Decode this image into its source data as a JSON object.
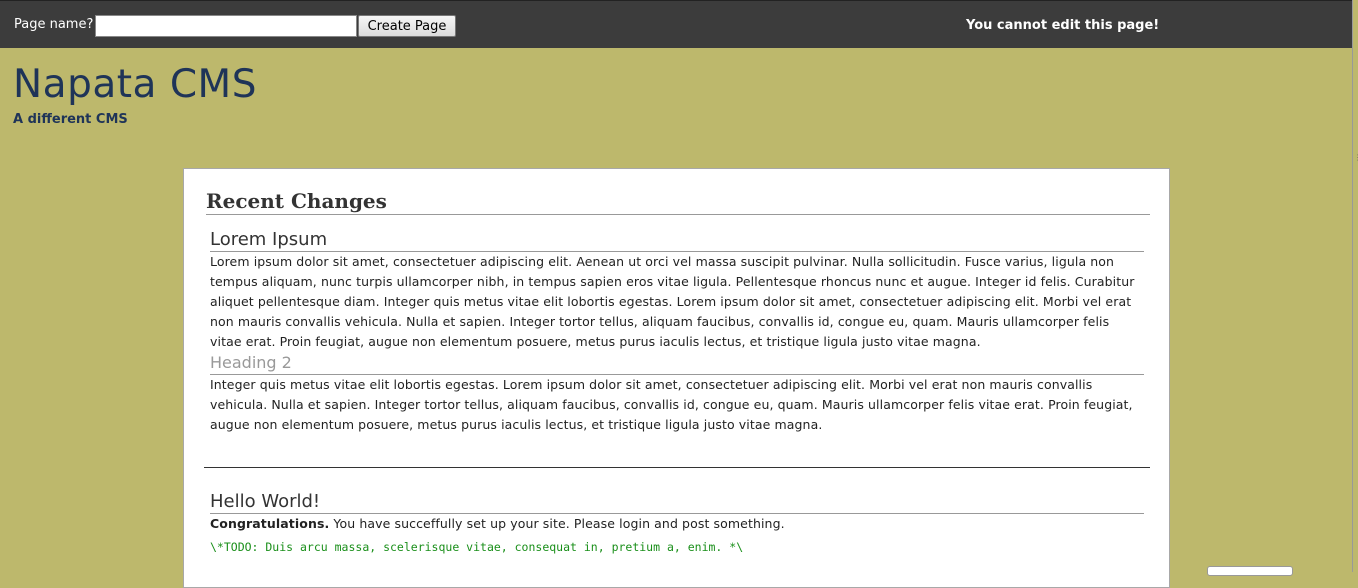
{
  "toolbar": {
    "page_name_label": "Page name?",
    "page_name_value": "",
    "create_button": "Create Page",
    "status": "You cannot edit this page!"
  },
  "site": {
    "title": "Napata CMS",
    "subtitle": "A different CMS"
  },
  "main": {
    "heading": "Recent Changes",
    "posts": [
      {
        "title": "Lorem Ipsum",
        "paragraph1": "Lorem ipsum dolor sit amet, consectetuer adipiscing elit. Aenean ut orci vel massa suscipit pulvinar. Nulla sollicitudin. Fusce varius, ligula non tempus aliquam, nunc turpis ullamcorper nibh, in tempus sapien eros vitae ligula. Pellentesque rhoncus nunc et augue. Integer id felis. Curabitur aliquet pellentesque diam. Integer quis metus vitae elit lobortis egestas. Lorem ipsum dolor sit amet, consectetuer adipiscing elit. Morbi vel erat non mauris convallis vehicula. Nulla et sapien. Integer tortor tellus, aliquam faucibus, convallis id, congue eu, quam. Mauris ullamcorper felis vitae erat. Proin feugiat, augue non elementum posuere, metus purus iaculis lectus, et tristique ligula justo vitae magna.",
        "subheading": "Heading 2",
        "paragraph2": "Integer quis metus vitae elit lobortis egestas. Lorem ipsum dolor sit amet, consectetuer adipiscing elit. Morbi vel erat non mauris convallis vehicula. Nulla et sapien. Integer tortor tellus, aliquam faucibus, convallis id, congue eu, quam. Mauris ullamcorper felis vitae erat. Proin feugiat, augue non elementum posuere, metus purus iaculis lectus, et tristique ligula justo vitae magna."
      },
      {
        "title": "Hello World!",
        "bold_lead": "Congratulations.",
        "text": " You have succeffully set up your site. Please login and post something.",
        "code": "\\*TODO: Duis arcu massa, scelerisque vitae, consequat in, pretium a, enim. *\\"
      }
    ]
  }
}
